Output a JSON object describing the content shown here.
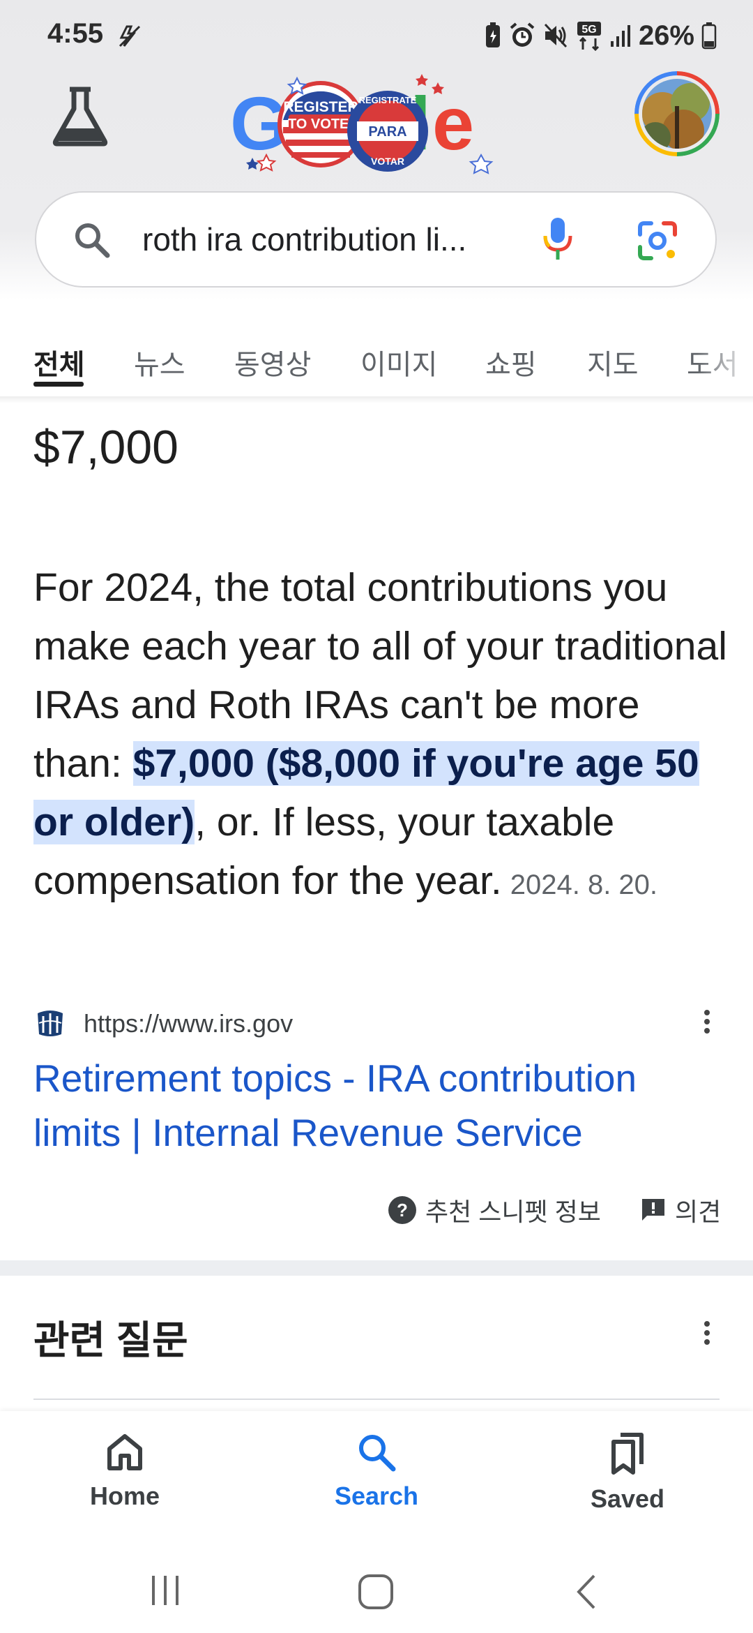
{
  "status": {
    "time": "4:55",
    "battery_percent": "26%"
  },
  "search": {
    "query": "roth ira contribution li..."
  },
  "tabs": [
    {
      "label": "전체",
      "active": true
    },
    {
      "label": "뉴스"
    },
    {
      "label": "동영상"
    },
    {
      "label": "이미지"
    },
    {
      "label": "쇼핑"
    },
    {
      "label": "지도"
    },
    {
      "label": "도서"
    }
  ],
  "featured": {
    "answer": "$7,000",
    "text_before": "For 2024, the total contributions you make each year to all of your traditional IRAs and Roth IRAs can't be more than: ",
    "highlight": "$7,000 ($8,000 if you're age 50 or older)",
    "text_after": ", or. If less, your taxable compensation for the year.",
    "date": "2024. 8. 20.",
    "source_url": "https://www.irs.gov",
    "result_title": "Retirement topics - IRA contribution limits | Internal Revenue Service",
    "about_label": "추천 스니펫 정보",
    "feedback_label": "의견"
  },
  "related": {
    "title": "관련 질문"
  },
  "bottom_nav": {
    "home": "Home",
    "search": "Search",
    "saved": "Saved"
  },
  "logo": {
    "badge1_line1": "REGISTER",
    "badge1_line2": "TO VOTE!",
    "badge2_line1": "REGISTRATE",
    "badge2_line2": "PARA",
    "badge2_line3": "VOTAR"
  },
  "colors": {
    "link": "#1a56c9",
    "highlight_bg": "#d3e3fd",
    "active_nav": "#1a73e8"
  }
}
